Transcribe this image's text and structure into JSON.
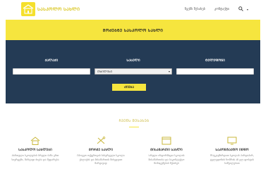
{
  "header": {
    "logo_text": "ᲡᲐᲡᲙᲝᲚᲝ ᲡᲐᲮᲚᲘ",
    "nav": [
      "ᲩᲕᲔᲜᲡ ᲨᲔᲡᲐᲮᲔᲑ",
      "ᲙᲝᲜᲢᲐᲥᲢᲘ"
    ],
    "icons": [
      "search-icon",
      "chevron-down-icon"
    ]
  },
  "banner": {
    "title": "ᲛᲝᲫᲔᲑᲜᲔ ᲡᲐᲡᲙᲝᲚᲝ ᲡᲐᲮᲚᲘ"
  },
  "search": {
    "col1_label": "ᲥᲐᲚᲐᲥᲘ",
    "col2_label": "ᲡᲐᲮᲔᲚᲘ",
    "col3_label": "ᲢᲔᲚᲔᲤᲝᲜᲘ",
    "select_value": "ᲗᲑᲘᲚᲘᲡᲘ",
    "button_label": "ᲫᲘᲔᲑᲐ"
  },
  "features": {
    "section_title": "ᲩᲕᲔᲜᲡ ᲨᲔᲡᲐᲮᲔᲑ",
    "items": [
      {
        "icon": "home-icon",
        "title": "ᲡᲐᲡᲙᲝᲚᲝ ᲡᲐᲮᲚᲔᲑᲘ",
        "desc": "Ქართული სკოლების სრული ბაზა ერთ სივრცეში, მარტივი ძიება და შედარება"
      },
      {
        "icon": "tools-icon",
        "title": "ᲛᲝᲠᲒᲔ ᲡᲐᲮᲚᲘ",
        "desc": "Იპოვეთ თქვენთვის სასურველი სკოლა ქალაქის და მისამართის მიხედვით მარტივად"
      },
      {
        "icon": "browser-icon",
        "title": "ᲛᲘᲡᲐᲛᲐᲠᲗᲘ ᲡᲐᲮᲚᲘ",
        "desc": "Სრული ინფორმაცია სკოლის მისამართისა და საკონტაქტო მონაცემების შესახებ"
      },
      {
        "icon": "monitor-icon",
        "title": "ᲡᲐᲙᲝᲜᲢᲐᲥᲢᲝ ᲘᲜᲤᲝ",
        "desc": "Დაუკავშირდით სკოლას პირდაპირ, ტელეფონის ნომრის ან ელ-ფოსტის საშუალებით"
      }
    ]
  },
  "colors": {
    "accent": "#f6e53e",
    "panel": "#243b55"
  }
}
